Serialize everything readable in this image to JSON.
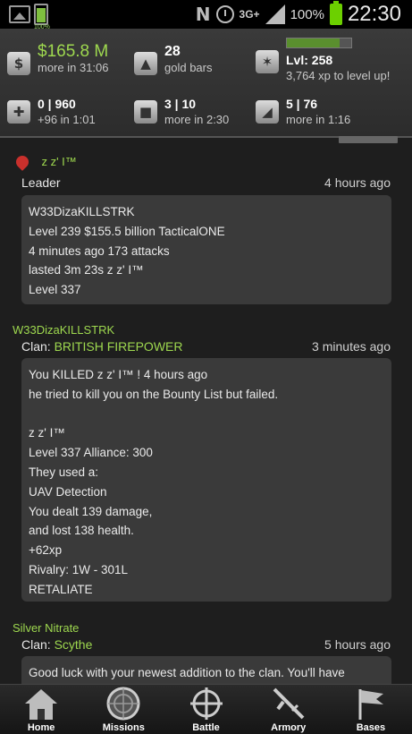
{
  "status_bar": {
    "small_battery_pct": "100%",
    "network": "3G+",
    "battery_pct": "100%",
    "time": "22:30"
  },
  "stats": {
    "money": {
      "value": "$165.8 M",
      "sub": "more in 31:06"
    },
    "gold": {
      "value": "28",
      "sub": "gold bars"
    },
    "level": {
      "value": "Lvl: 258",
      "sub": "3,764 xp to level up!",
      "progress": 0.82
    },
    "health": {
      "value": "0 | 960",
      "sub": "+96 in 1:01"
    },
    "energy": {
      "value": "3 | 10",
      "sub": "more in 2:30"
    },
    "ammo": {
      "value": "5 | 76",
      "sub": "more in 1:16"
    }
  },
  "feed": [
    {
      "name": "z z' I™",
      "role": "Leader",
      "time": "4 hours ago",
      "lines": [
        "W33DizaKILLSTRK",
        "Level 239 $155.5 billion TacticalONE",
        "4 minutes ago 173 attacks",
        "lasted 3m 23s  z z' I™",
        "Level 337"
      ]
    },
    {
      "name": "W33DizaKILLSTRK",
      "clan_prefix": "Clan:",
      "clan": "BRITISH FIREPOWER",
      "time": "3 minutes ago",
      "lines": [
        "You KILLED  z z' I™ ! 4 hours ago",
        "he tried to kill you on the Bounty List but failed.",
        "",
        " z z' I™",
        "Level 337 Alliance: 300",
        "They used a:",
        "UAV Detection",
        "You dealt 139 damage,",
        "and lost 138 health.",
        "+62xp",
        "Rivalry: 1W - 301L",
        "RETALIATE"
      ]
    },
    {
      "name": "Silver Nitrate",
      "clan_prefix": "Clan:",
      "clan": "Scythe",
      "time": "5 hours ago",
      "lines": [
        "Good luck with your newest addition to the clan. You'll have"
      ]
    }
  ],
  "nav": [
    "Home",
    "Missions",
    "Battle",
    "Armory",
    "Bases"
  ],
  "colors": {
    "accent_green": "#9ed84f",
    "bubble": "#3a3a3a"
  }
}
